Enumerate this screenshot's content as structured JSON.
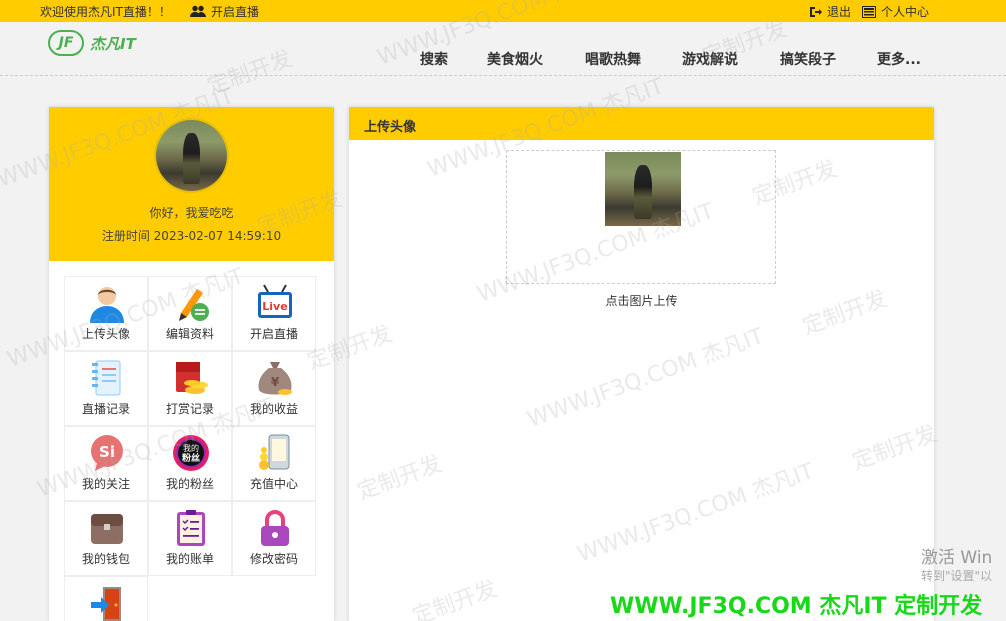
{
  "topbar": {
    "welcome": "欢迎使用杰凡IT直播！！",
    "live_link": "开启直播",
    "logout": "退出",
    "user_center": "个人中心"
  },
  "logo": {
    "mark": "JF",
    "text": "杰凡IT"
  },
  "nav": [
    {
      "label": "搜索"
    },
    {
      "label": "美食烟火"
    },
    {
      "label": "唱歌热舞"
    },
    {
      "label": "游戏解说"
    },
    {
      "label": "搞笑段子"
    },
    {
      "label": "更多..."
    }
  ],
  "profile": {
    "greeting": "你好，我爱吃吃",
    "register_time": "注册时间 2023-02-07 14:59:10"
  },
  "menu": [
    {
      "label": "上传头像",
      "icon": "user-avatar-icon"
    },
    {
      "label": "编辑资料",
      "icon": "edit-pencil-icon"
    },
    {
      "label": "开启直播",
      "icon": "live-tv-icon"
    },
    {
      "label": "直播记录",
      "icon": "notebook-icon"
    },
    {
      "label": "打赏记录",
      "icon": "red-envelope-icon"
    },
    {
      "label": "我的收益",
      "icon": "money-bag-icon"
    },
    {
      "label": "我的关注",
      "icon": "follow-bubble-icon"
    },
    {
      "label": "我的粉丝",
      "icon": "fans-badge-icon"
    },
    {
      "label": "充值中心",
      "icon": "recharge-phone-icon"
    },
    {
      "label": "我的钱包",
      "icon": "wallet-icon"
    },
    {
      "label": "我的账单",
      "icon": "bill-clipboard-icon"
    },
    {
      "label": "修改密码",
      "icon": "padlock-icon"
    },
    {
      "label": "",
      "icon": "exit-door-icon"
    }
  ],
  "icon_text": {
    "live": "Live",
    "follow": "Si",
    "fans_top": "我的",
    "fans_bottom": "粉丝"
  },
  "main": {
    "title": "上传头像",
    "upload_label": "点击图片上传"
  },
  "watermark": {
    "site": "WWW.JF3Q.COM 杰凡IT",
    "custom": "定制开发",
    "promo": "WWW.JF3Q.COM 杰凡IT  定制开发"
  },
  "system": {
    "activate": "激活 Win",
    "activate_hint": "转到\"设置\"以"
  },
  "colors": {
    "accent": "#ffcc00",
    "brand_green": "#4caf50",
    "promo_green": "#19d719"
  }
}
